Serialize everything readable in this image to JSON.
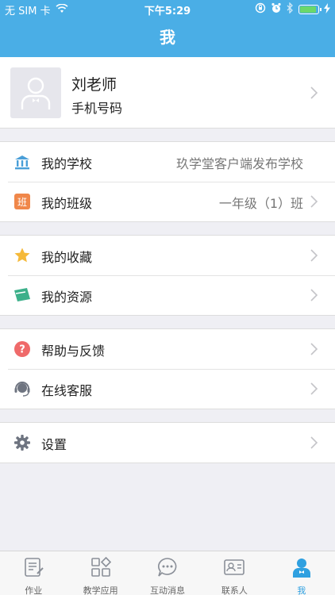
{
  "status_bar": {
    "carrier": "无 SIM 卡",
    "time": "下午5:29"
  },
  "nav": {
    "title": "我"
  },
  "profile": {
    "name": "刘老师",
    "subtitle": "手机号码"
  },
  "groups": [
    [
      {
        "icon": "school-icon",
        "label": "我的学校",
        "value": "玖学堂客户端发布学校",
        "arrow": false
      },
      {
        "icon": "class-icon",
        "label": "我的班级",
        "value": "一年级（1）班",
        "arrow": true
      }
    ],
    [
      {
        "icon": "star-icon",
        "label": "我的收藏",
        "value": "",
        "arrow": true
      },
      {
        "icon": "resource-icon",
        "label": "我的资源",
        "value": "",
        "arrow": true
      }
    ],
    [
      {
        "icon": "help-icon",
        "label": "帮助与反馈",
        "value": "",
        "arrow": true
      },
      {
        "icon": "headset-icon",
        "label": "在线客服",
        "value": "",
        "arrow": true
      }
    ],
    [
      {
        "icon": "gear-icon",
        "label": "设置",
        "value": "",
        "arrow": true
      }
    ]
  ],
  "tabs": [
    {
      "icon": "homework-icon",
      "label": "作业",
      "active": false
    },
    {
      "icon": "apps-icon",
      "label": "教学应用",
      "active": false
    },
    {
      "icon": "chat-icon",
      "label": "互动消息",
      "active": false
    },
    {
      "icon": "contacts-icon",
      "label": "联系人",
      "active": false
    },
    {
      "icon": "me-icon",
      "label": "我",
      "active": true
    }
  ],
  "colors": {
    "accent": "#4aaee6",
    "tab_active": "#2fa0e0",
    "background": "#efeff4"
  }
}
